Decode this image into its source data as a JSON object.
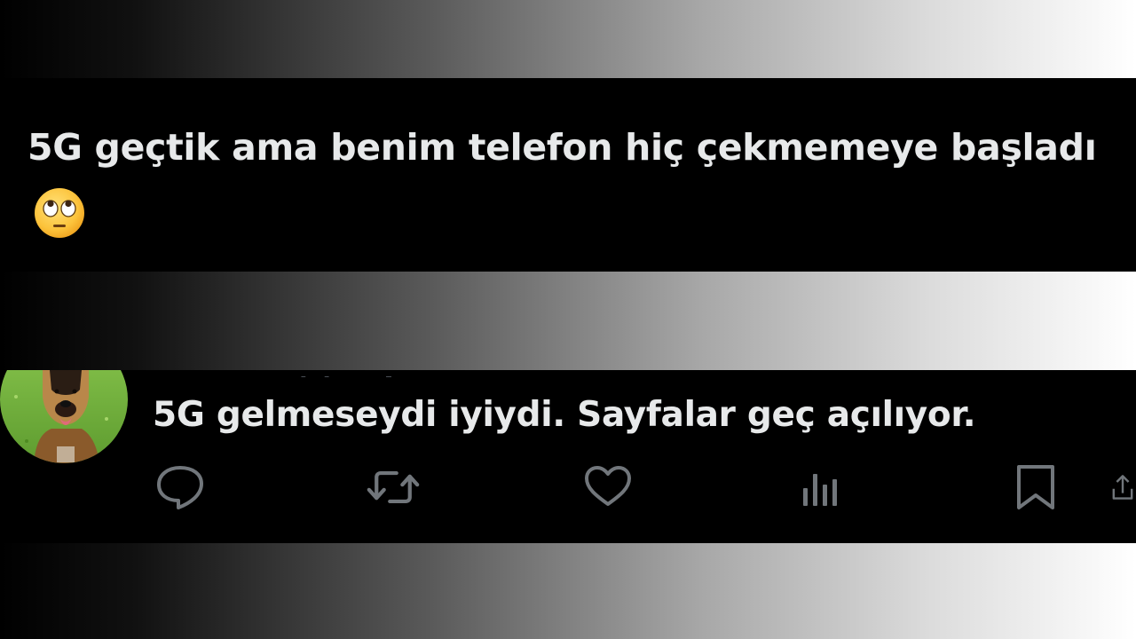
{
  "tweet_main": {
    "text": "5G geçtik ama benim telefon hiç çekmemeye başladı",
    "emoji": "face-with-rolling-eyes"
  },
  "reply": {
    "text": "5G gelmeseydi iyiydi. Sayfalar geç açılıyor.",
    "avatar": "dog-photo",
    "actions": [
      {
        "name": "reply",
        "icon": "comment-icon"
      },
      {
        "name": "retweet",
        "icon": "retweet-icon"
      },
      {
        "name": "like",
        "icon": "heart-icon"
      },
      {
        "name": "views",
        "icon": "analytics-icon"
      },
      {
        "name": "bookmark",
        "icon": "bookmark-icon"
      },
      {
        "name": "share",
        "icon": "share-icon"
      }
    ]
  },
  "colors": {
    "panel_background": "#000000",
    "text": "#e7e9ea",
    "icon": "#71767b",
    "avatar_grass": "#6aa83a"
  }
}
